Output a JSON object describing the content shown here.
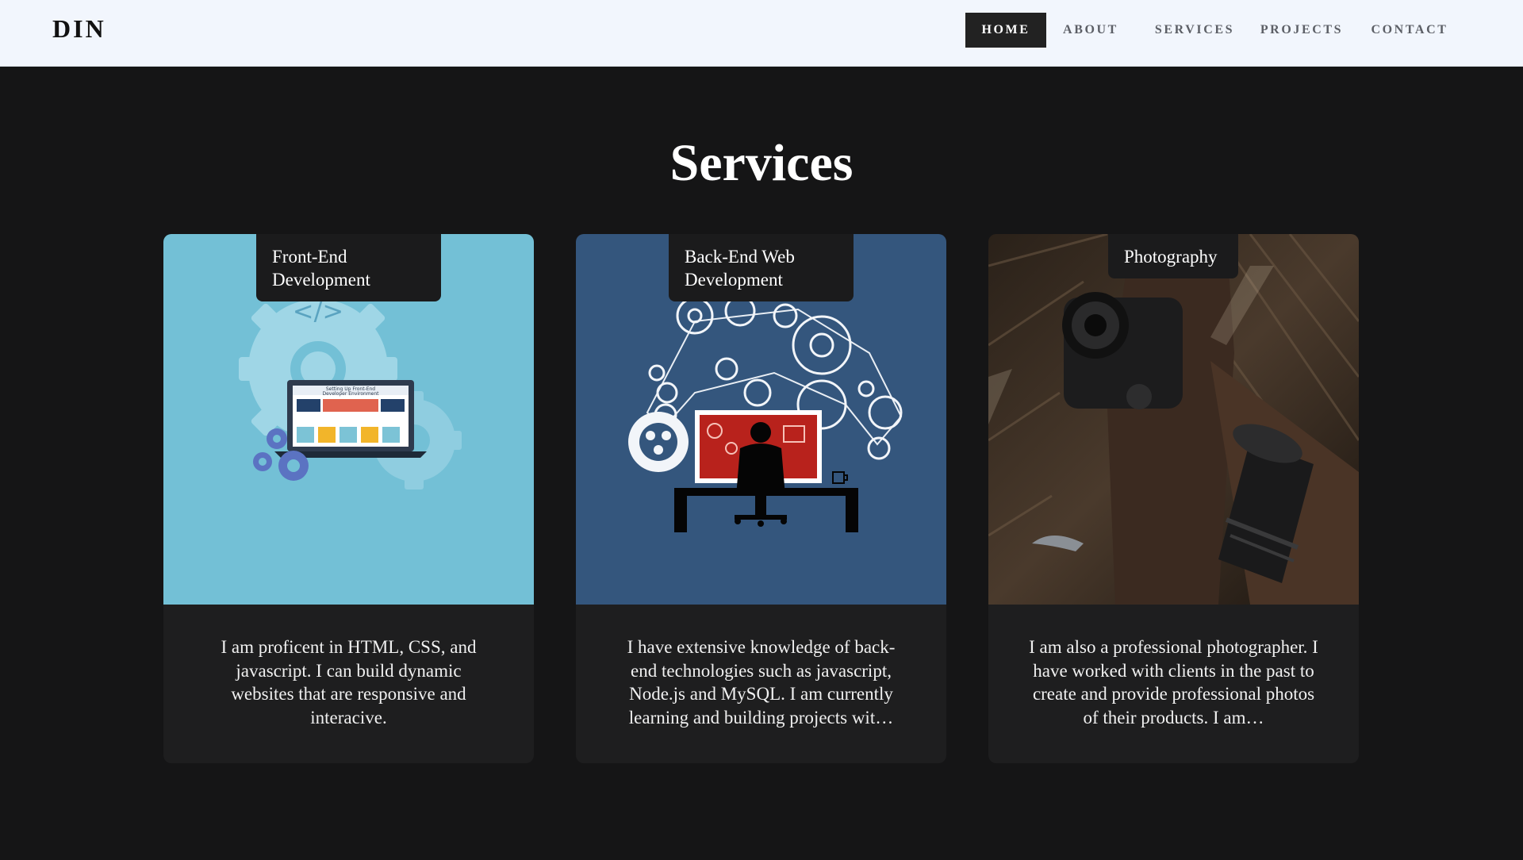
{
  "brand": "DIN",
  "nav": {
    "items": [
      {
        "label": "HOME",
        "active": true
      },
      {
        "label": "ABOUT",
        "active": false
      },
      {
        "label": "SERVICES",
        "active": false
      },
      {
        "label": "PROJECTS",
        "active": false
      },
      {
        "label": "CONTACT",
        "active": false
      }
    ]
  },
  "services": {
    "title": "Services",
    "cards": [
      {
        "title_lines": [
          "Front-End",
          "Development"
        ],
        "image_label_lines": [
          "Setting Up Front-End",
          "Developer Environment"
        ],
        "description": "I am proficent in HTML, CSS, and javascript. I can build dynamic websites that are responsive and interacive."
      },
      {
        "title_lines": [
          "Back-End Web",
          "Development"
        ],
        "description": "I have extensive knowledge of back-end technologies such as javascript, Node.js and MySQL. I am currently learning and building projects wit…"
      },
      {
        "title_lines": [
          "Photography"
        ],
        "description": "I am also a professional photographer. I have worked with clients in the past to create and provide professional photos of their products. I am…"
      }
    ]
  },
  "colors": {
    "nav_bg": "#f2f6fd",
    "page_bg": "#151516",
    "card_bg": "#1e1e1f",
    "frontend_img_bg": "#73c0d6",
    "backend_img_bg": "#34567d"
  }
}
